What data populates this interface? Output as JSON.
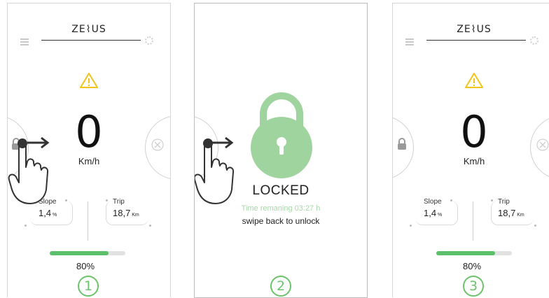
{
  "brand": {
    "logo_text": "ZE⌇US"
  },
  "dashboard": {
    "speed": "0",
    "speed_unit": "Km/h",
    "slope_label": "Slope",
    "slope_value": "1,4",
    "slope_unit": "%",
    "trip_label": "Trip",
    "trip_value": "18,7",
    "trip_unit": "Km",
    "battery_percent": "80%",
    "battery_level": 0.78
  },
  "lock_screen": {
    "title": "LOCKED",
    "time_text": "Time remaning 03:27 h",
    "hint": "swipe back to unlock"
  },
  "steps": [
    "1",
    "2",
    "3"
  ],
  "colors": {
    "accent_green": "#5cbf6a",
    "lock_green": "#9fd49f",
    "warning_yellow": "#f0c419"
  },
  "icons": [
    "menu-icon",
    "gear-icon",
    "warning-icon",
    "lock-icon",
    "zeus-icon",
    "hand-swipe-icon",
    "arrow-right-icon"
  ]
}
